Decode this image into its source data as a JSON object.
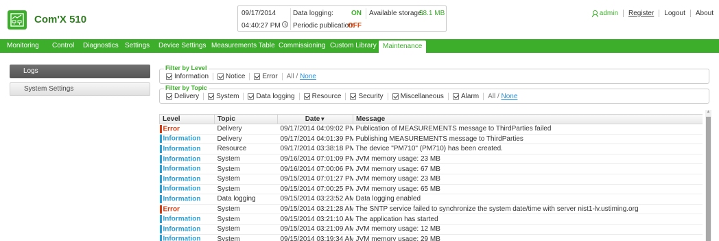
{
  "header": {
    "product_name": "Com'X 510",
    "status": {
      "date": "09/17/2014",
      "time": "04:40:27 PM",
      "data_logging_label": "Data logging:",
      "data_logging_value": "ON",
      "periodic_label": "Periodic publication:",
      "periodic_value": "OFF",
      "storage_label": "Available storage:",
      "storage_value": "58.1 MB"
    },
    "user": "admin",
    "links": {
      "register": "Register",
      "logout": "Logout",
      "about": "About"
    }
  },
  "nav": {
    "items": [
      {
        "label": "Monitoring"
      },
      {
        "label": "Control"
      },
      {
        "label": "Diagnostics"
      },
      {
        "label": "Settings"
      },
      {
        "label": "Device Settings"
      },
      {
        "label": "Measurements Table"
      },
      {
        "label": "Commissioning"
      },
      {
        "label": "Custom Library"
      },
      {
        "label": "Maintenance",
        "active": true
      }
    ]
  },
  "sidebar": {
    "items": [
      {
        "label": "Logs",
        "active": true
      },
      {
        "label": "System Settings"
      }
    ]
  },
  "filters": {
    "level": {
      "legend": "Filter by Level",
      "options": [
        "Information",
        "Notice",
        "Error"
      ],
      "all": "All /",
      "none": "None"
    },
    "topic": {
      "legend": "Filter by Topic",
      "options": [
        "Delivery",
        "System",
        "Data logging",
        "Resource",
        "Security",
        "Miscellaneous",
        "Alarm"
      ],
      "all": "All /",
      "none": "None"
    }
  },
  "table": {
    "headers": {
      "level": "Level",
      "topic": "Topic",
      "date": "Date",
      "date_sort": "▼",
      "message": "Message"
    },
    "rows": [
      {
        "level": "Error",
        "topic": "Delivery",
        "date": "09/17/2014 04:09:02 PM",
        "message": "Publication of MEASUREMENTS message to ThirdParties failed"
      },
      {
        "level": "Information",
        "topic": "Delivery",
        "date": "09/17/2014 04:01:39 PM",
        "message": "Publishing MEASUREMENTS message to ThirdParties"
      },
      {
        "level": "Information",
        "topic": "Resource",
        "date": "09/17/2014 03:38:18 PM",
        "message": "The device \"PM710\" (PM710) has been created."
      },
      {
        "level": "Information",
        "topic": "System",
        "date": "09/16/2014 07:01:09 PM",
        "message": "JVM memory usage: 23 MB"
      },
      {
        "level": "Information",
        "topic": "System",
        "date": "09/16/2014 07:00:06 PM",
        "message": "JVM memory usage: 67 MB"
      },
      {
        "level": "Information",
        "topic": "System",
        "date": "09/15/2014 07:01:27 PM",
        "message": "JVM memory usage: 23 MB"
      },
      {
        "level": "Information",
        "topic": "System",
        "date": "09/15/2014 07:00:25 PM",
        "message": "JVM memory usage: 65 MB"
      },
      {
        "level": "Information",
        "topic": "Data logging",
        "date": "09/15/2014 03:23:52 AM",
        "message": "Data logging enabled"
      },
      {
        "level": "Error",
        "topic": "System",
        "date": "09/15/2014 03:21:28 AM",
        "message": "The SNTP service failed to synchronize the system date/time with server nist1-lv.ustiming.org"
      },
      {
        "level": "Information",
        "topic": "System",
        "date": "09/15/2014 03:21:10 AM",
        "message": "The application has started"
      },
      {
        "level": "Information",
        "topic": "System",
        "date": "09/15/2014 03:21:09 AM",
        "message": "JVM memory usage: 12 MB"
      },
      {
        "level": "Information",
        "topic": "System",
        "date": "09/15/2014 03:19:34 AM",
        "message": "JVM memory usage: 29 MB"
      }
    ]
  },
  "colors": {
    "brand": "#3dae2b",
    "error": "#d03b12",
    "info": "#2a9fd6",
    "off": "#e24a10"
  }
}
